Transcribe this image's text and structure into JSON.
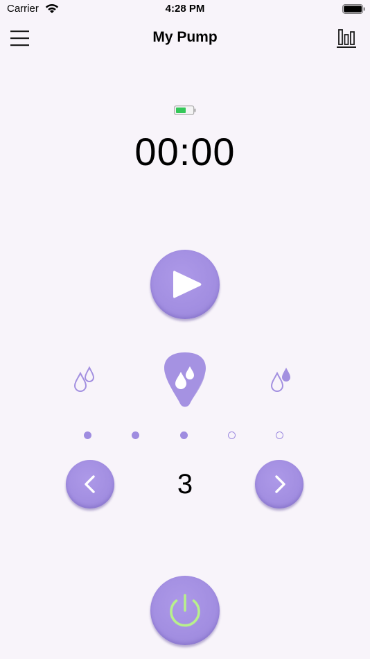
{
  "status_bar": {
    "carrier": "Carrier",
    "time": "4:28 PM",
    "wifi_icon": "wifi-icon",
    "battery_icon": "battery-full-icon"
  },
  "nav": {
    "title": "My Pump",
    "menu_icon": "hamburger-menu-icon",
    "stats_icon": "bar-chart-icon"
  },
  "device": {
    "battery_icon": "battery-icon",
    "battery_color": "#34c759",
    "timer": "00:00"
  },
  "controls": {
    "play_icon": "play-icon",
    "prev_icon": "chevron-left-icon",
    "next_icon": "chevron-right-icon",
    "power_icon": "power-icon",
    "power_color": "#b8f08c",
    "accent_color": "#a592e2"
  },
  "modes": {
    "items": [
      "light-drops-icon",
      "drops-icon",
      "heavy-drops-icon"
    ],
    "selected_index": 1
  },
  "level": {
    "value": "3",
    "dots": [
      true,
      true,
      true,
      false,
      false
    ]
  }
}
